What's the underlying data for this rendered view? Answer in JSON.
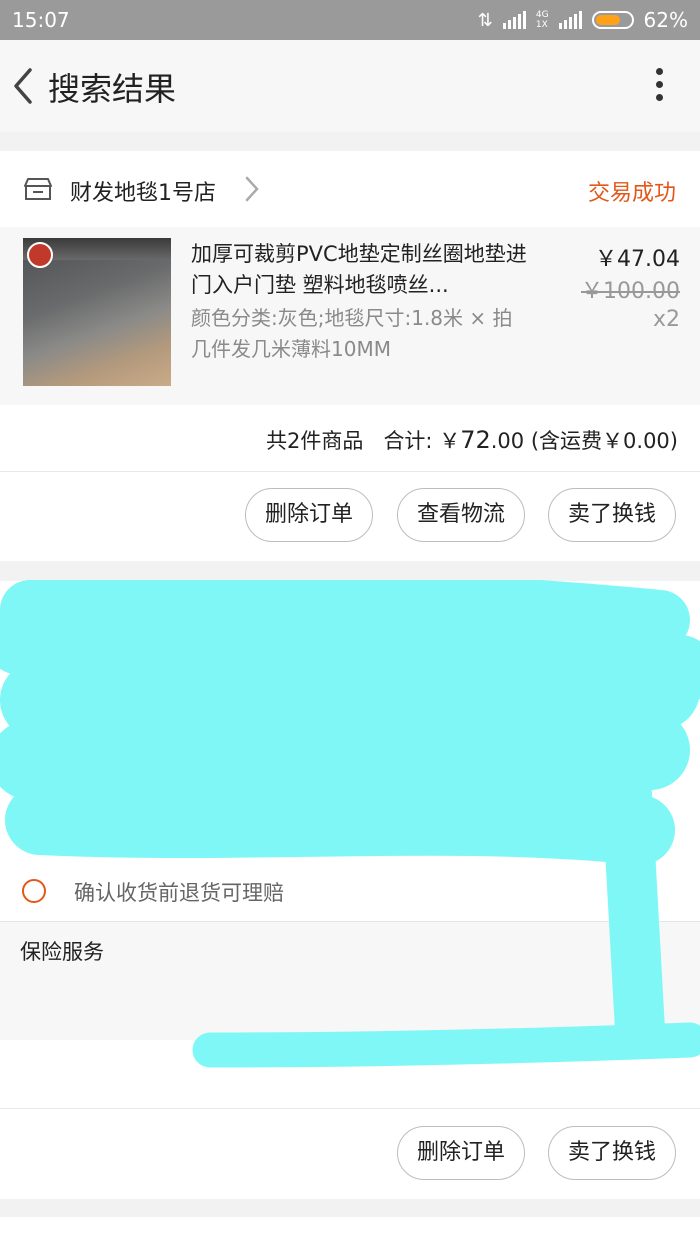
{
  "status_bar": {
    "time": "15:07",
    "network": "4G\n1X",
    "battery": "62%",
    "battery_level": 0.62
  },
  "header": {
    "title": "搜索结果",
    "back_icon": "chevron-left-icon",
    "more_icon": "more-vertical-icon"
  },
  "order1": {
    "shop_name": "财发地毯1号店",
    "status": "交易成功",
    "item_title": "加厚可裁剪PVC地垫定制丝圈地垫进门入户门垫 塑料地毯喷丝...",
    "item_spec": "颜色分类:灰色;地毯尺寸:1.8米 × 拍几件发几米薄料10MM",
    "price": "￥47.04",
    "original_price": "￥100.00",
    "quantity": "x2",
    "summary_count": "共2件商品",
    "summary_total_label": "合计: ￥",
    "summary_total_int": "72",
    "summary_total_dec": ".00",
    "summary_shipping": "(含运费￥0.00)",
    "buttons": [
      "删除订单",
      "查看物流",
      "卖了换钱"
    ],
    "colors": {
      "status": "#e2581a"
    }
  },
  "order2": {
    "guarantee_text": "确认收货前退货可理赔",
    "insurance_label": "保险服务",
    "buttons": [
      "删除订单",
      "卖了换钱"
    ]
  },
  "redaction": {
    "color": "#7ff7f7"
  }
}
